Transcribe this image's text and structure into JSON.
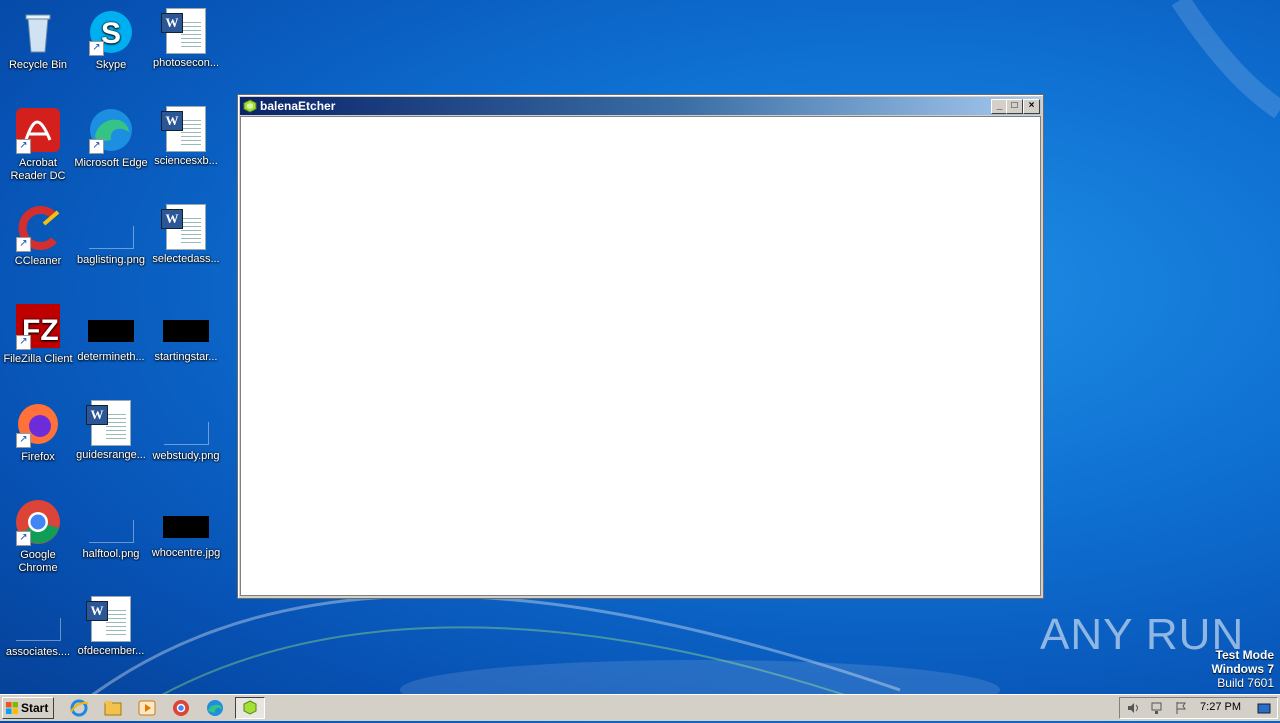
{
  "desktop": {
    "icons": [
      {
        "label": "Recycle Bin"
      },
      {
        "label": "Skype"
      },
      {
        "label": "photosecon..."
      },
      {
        "label": "Acrobat Reader DC"
      },
      {
        "label": "Microsoft Edge"
      },
      {
        "label": "sciencesxb..."
      },
      {
        "label": "CCleaner"
      },
      {
        "label": "baglisting.png"
      },
      {
        "label": "selectedass..."
      },
      {
        "label": "FileZilla Client"
      },
      {
        "label": "determineth..."
      },
      {
        "label": "startingstar..."
      },
      {
        "label": "Firefox"
      },
      {
        "label": "guidesrange..."
      },
      {
        "label": "webstudy.png"
      },
      {
        "label": "Google Chrome"
      },
      {
        "label": "halftool.png"
      },
      {
        "label": "whocentre.jpg"
      },
      {
        "label": "associates...."
      },
      {
        "label": "ofdecember..."
      }
    ]
  },
  "window": {
    "title": "balenaEtcher",
    "minimize_glyph": "_",
    "maximize_glyph": "□",
    "close_glyph": "×"
  },
  "watermark": {
    "text": "ANY RUN",
    "line1": "Test Mode",
    "line2": "Windows 7",
    "line3": "Build 7601"
  },
  "taskbar": {
    "start_label": "Start",
    "clock": "7:27 PM"
  },
  "colors": {
    "desktop": "#0e6fd1",
    "titlebar_start": "#0a246a",
    "titlebar_end": "#a6caf0",
    "taskbar": "#d4d0c8"
  }
}
